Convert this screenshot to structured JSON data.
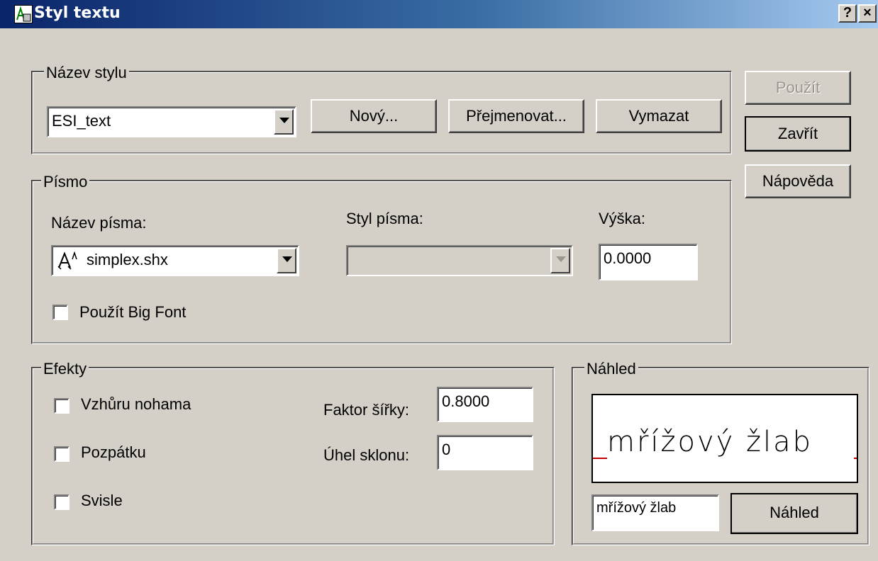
{
  "window": {
    "title": "Styl textu",
    "help_glyph": "?",
    "close_glyph": "×"
  },
  "style_name": {
    "legend": "Název stylu",
    "selected": "ESI_text",
    "new_label": "Nový...",
    "rename_label": "Přejmenovat...",
    "delete_label": "Vymazat"
  },
  "side_buttons": {
    "apply_label": "Použít",
    "close_label": "Zavřít",
    "help_label": "Nápověda"
  },
  "font": {
    "legend": "Písmo",
    "name_label": "Název písma:",
    "name_value": "simplex.shx",
    "style_label": "Styl písma:",
    "style_value": "",
    "height_label": "Výška:",
    "height_value": "0.0000",
    "bigfont_label": "Použít Big Font"
  },
  "effects": {
    "legend": "Efekty",
    "upside_down_label": "Vzhůru nohama",
    "backwards_label": "Pozpátku",
    "vertical_label": "Svisle",
    "width_factor_label": "Faktor šířky:",
    "width_factor_value": "0.8000",
    "oblique_label": "Úhel sklonu:",
    "oblique_value": "0"
  },
  "preview": {
    "legend": "Náhled",
    "sample_text": "mřížový žlab",
    "input_value": "mřížový žlab",
    "button_label": "Náhled"
  },
  "colors": {
    "face": "#d4d0c8",
    "title_start": "#0a246a",
    "title_end": "#a6caf0",
    "baseline": "#c00000"
  }
}
